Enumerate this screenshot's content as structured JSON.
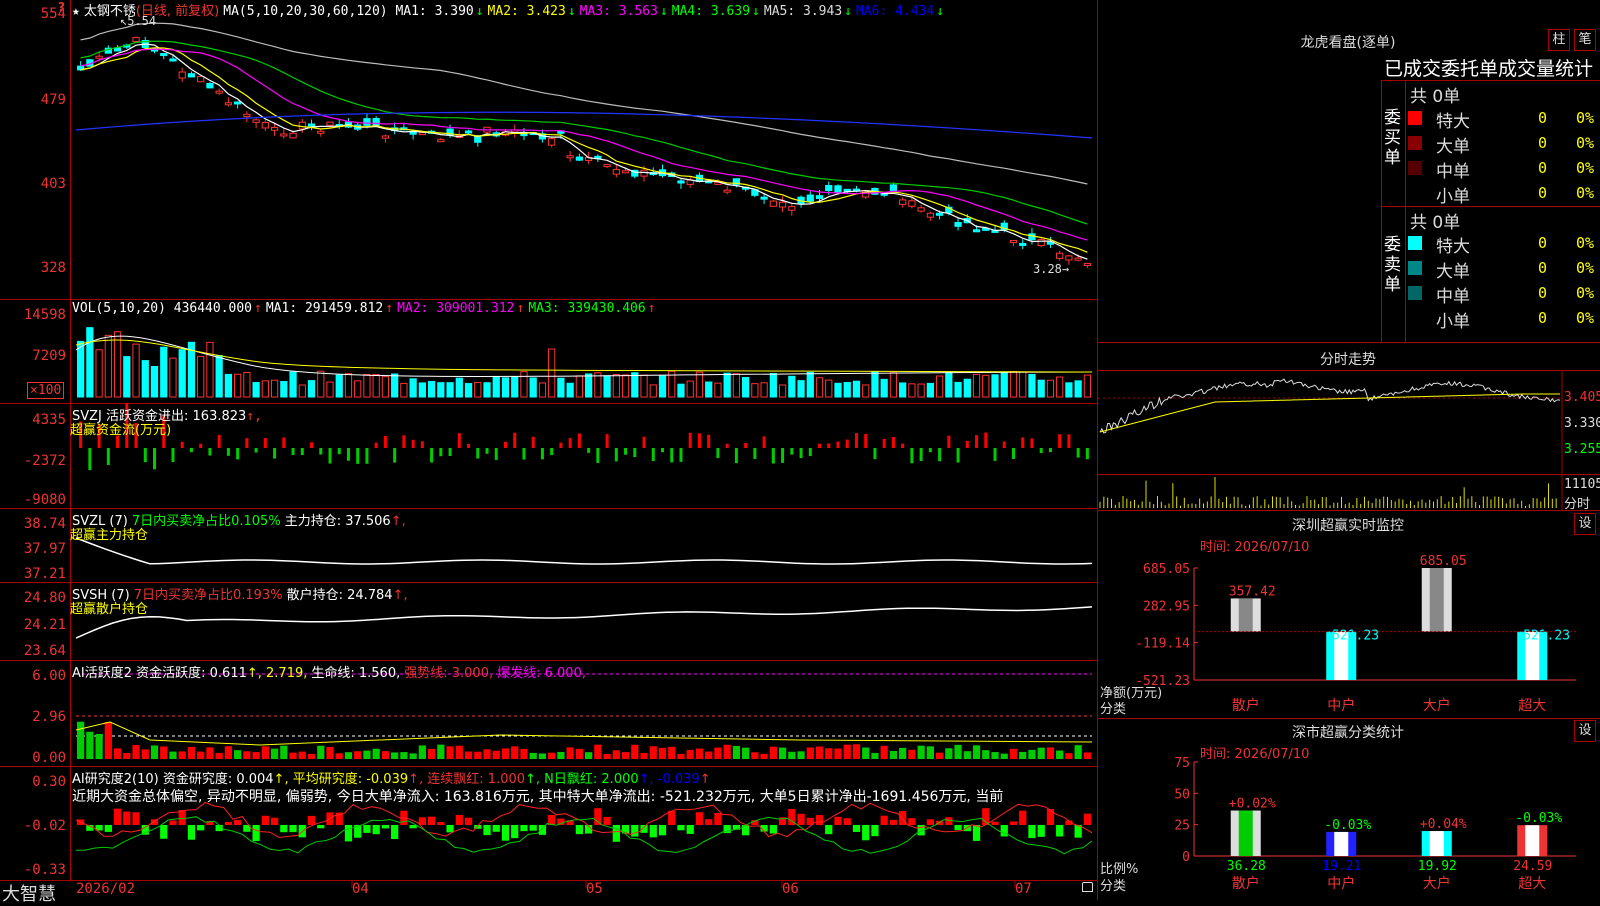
{
  "stock": {
    "name": "太钢不锈",
    "period": "(日线, 前复权)",
    "high_label": "5.54",
    "low_label": "3.28"
  },
  "app": {
    "logo": "大智慧",
    "wave_icon": "?"
  },
  "price_panel": {
    "y_ticks": [
      "554",
      "479",
      "403",
      "328"
    ],
    "ma_items": [
      {
        "label": "MA(5,10,20,30,60,120) MA1:",
        "value": "3.390",
        "arrow": "↓",
        "color": "#ffffff"
      },
      {
        "label": "MA2:",
        "value": "3.423",
        "arrow": "↓",
        "color": "#ffff00"
      },
      {
        "label": "MA3:",
        "value": "3.563",
        "arrow": "↓",
        "color": "#ff00ff"
      },
      {
        "label": "MA4:",
        "value": "3.639",
        "arrow": "↓",
        "color": "#00ff00"
      },
      {
        "label": "MA5:",
        "value": "3.943",
        "arrow": "↓",
        "color": "#dddddd"
      },
      {
        "label": "MA6:",
        "value": "4.434",
        "arrow": "↓",
        "color": "#0000ff"
      }
    ]
  },
  "volume_panel": {
    "y_ticks": [
      "14598",
      "7209",
      "×100"
    ],
    "items": [
      {
        "label": "VOL(5,10,20)",
        "value": "436440.000",
        "arrow": "↑",
        "color": "#ffffff"
      },
      {
        "label": "MA1:",
        "value": "291459.812",
        "arrow": "↑",
        "color": "#ffffff"
      },
      {
        "label": "MA2:",
        "value": "309001.312",
        "arrow": "↑",
        "color": "#ff00ff"
      },
      {
        "label": "MA3:",
        "value": "339430.406",
        "arrow": "↑",
        "color": "#00ff00"
      }
    ]
  },
  "svzj_panel": {
    "y_ticks": [
      "4335",
      "-2372",
      "-9080"
    ],
    "header": "SVZJ  活跃资金进出: 163.823",
    "arrow": "↑,",
    "subtitle": "超赢资金流(万元)"
  },
  "svzl_panel": {
    "y_ticks": [
      "38.74",
      "37.97",
      "37.21"
    ],
    "header_a": "SVZL (7)",
    "header_b": "7日内买卖净占比0.105%",
    "header_c": "主力持仓: 37.506",
    "arrow": "↑,",
    "subtitle": "超赢主力持仓"
  },
  "svsh_panel": {
    "y_ticks": [
      "24.80",
      "24.21",
      "23.64"
    ],
    "header_a": "SVSH (7)",
    "header_b": "7日内买卖净占比0.193%",
    "header_c": "散户持仓: 24.784",
    "arrow": "↑,",
    "subtitle": "超赢散户持仓"
  },
  "ai_active_panel": {
    "y_ticks": [
      "6.00",
      "2.96",
      "0.00"
    ],
    "header_a": "AI活跃度2 资金活跃度: 0.611",
    "header_b": "↑, 2.719,",
    "header_c": "生命线: 1.560,",
    "header_d": "强势线: 3.000,",
    "header_e": "爆发线: 6.000,"
  },
  "ai_research_panel": {
    "y_ticks": [
      "0.30",
      "-0.02",
      "-0.33"
    ],
    "header_a": "AI研究度2(10) 资金研究度: 0.004",
    "header_b": "↑, 平均研究度: -0.039",
    "header_c": "↑, 连续飘红: 1.000",
    "header_d": "↑, N日飘红: 2.000",
    "header_e": "↑, -0.039",
    "header_f": "↑",
    "summary": "近期大资金总体偏空, 异动不明显, 偏弱势, 今日大单净流入: 163.816万元, 其中特大单净流出: -521.232万元, 大单5日累计净出-1691.456万元, 当前"
  },
  "x_axis": [
    "2026/02",
    "04",
    "05",
    "06",
    "07"
  ],
  "longhu": {
    "title": "龙虎看盘(逐单)",
    "btn1": "柱",
    "btn2": "笔",
    "subtitle": "已成交委托单成交量统计",
    "buy": {
      "side_label": "委买单",
      "total": "共 0单",
      "rows": [
        {
          "label": "特大",
          "count": "0",
          "pct": "0%",
          "color": "#ff0000"
        },
        {
          "label": "大单",
          "count": "0",
          "pct": "0%",
          "color": "#880000"
        },
        {
          "label": "中单",
          "count": "0",
          "pct": "0%",
          "color": "#550000"
        },
        {
          "label": "小单",
          "count": "0",
          "pct": "0%",
          "color": ""
        }
      ]
    },
    "sell": {
      "side_label": "委卖单",
      "total": "共 0单",
      "rows": [
        {
          "label": "特大",
          "count": "0",
          "pct": "0%",
          "color": "#00ffff"
        },
        {
          "label": "大单",
          "count": "0",
          "pct": "0%",
          "color": "#008888"
        },
        {
          "label": "中单",
          "count": "0",
          "pct": "0%",
          "color": "#006666"
        },
        {
          "label": "小单",
          "count": "0",
          "pct": "0%",
          "color": ""
        }
      ]
    }
  },
  "intraday": {
    "title": "分时走势",
    "y_ticks": [
      "3.405",
      "3.330",
      "3.255"
    ],
    "vol_tick": "11105",
    "vol_label": "分时"
  },
  "monitor": {
    "title": "深圳超赢实时监控",
    "settings": "设",
    "time": "时间: 2026/07/10",
    "y_ticks": [
      "685.05",
      "282.95",
      "-119.14",
      "-521.23"
    ],
    "ylabel": "净额(万元)",
    "xlabel": "分类",
    "chart_data": {
      "type": "bar",
      "categories": [
        "散户",
        "中户",
        "大户",
        "超大"
      ],
      "values": [
        357.42,
        -521.23,
        685.05,
        -521.23
      ],
      "ylim": [
        -521.23,
        685.05
      ]
    }
  },
  "classify": {
    "title": "深市超赢分类统计",
    "settings": "设",
    "time": "时间: 2026/07/10",
    "y_ticks": [
      "75",
      "50",
      "25",
      "0"
    ],
    "ylabel": "比例%",
    "xlabel": "分类",
    "chart_data": {
      "type": "bar",
      "categories": [
        "散户",
        "中户",
        "大户",
        "超大"
      ],
      "values": [
        36.28,
        19.21,
        19.92,
        24.59
      ],
      "changes": [
        "+0.02%",
        "-0.03%",
        "+0.04%",
        "-0.03%"
      ],
      "ylim": [
        0,
        75
      ]
    }
  }
}
